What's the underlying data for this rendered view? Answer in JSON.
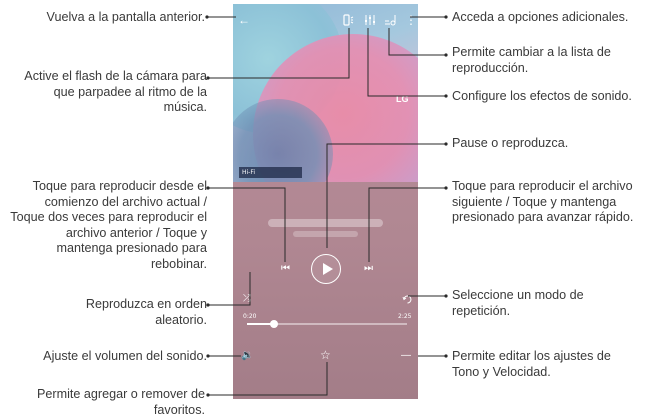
{
  "annotations": {
    "back": "Vuelva a la pantalla anterior.",
    "flash": "Active el flash de la cámara para que parpadee al ritmo de la música.",
    "restart": "Toque para reproducir desde el comienzo del archivo actual / Toque dos veces para reproducir el archivo anterior / Toque y mantenga presionado para rebobinar.",
    "shuffle": "Reproduzca en orden aleatorio.",
    "volume": "Ajuste el volumen del sonido.",
    "favorite": "Permite agregar o remover de favoritos.",
    "more": "Acceda a opciones adicionales.",
    "playlist": "Permite cambiar a la lista de reproducción.",
    "effects": "Configure los efectos de sonido.",
    "play": "Pause o reproduzca.",
    "next": "Toque para reproducir el archivo siguiente / Toque y mantenga presionado para avanzar rápido.",
    "repeat": "Seleccione un modo de repetición.",
    "pitch": "Permite editar los ajustes de Tono y Velocidad."
  },
  "player": {
    "hifi_badge": "Hi-Fi",
    "brand": "LG",
    "elapsed": "0:20",
    "total": "2:25",
    "progress": 0.17,
    "icons": {
      "back": "back-arrow-icon",
      "flash": "flash-icon",
      "effects": "equalizer-icon",
      "playlist": "playlist-icon",
      "more": "more-vertical-icon",
      "prev": "previous-icon",
      "play": "play-icon",
      "next": "next-icon",
      "shuffle": "shuffle-icon",
      "repeat": "repeat-icon",
      "volume": "volume-icon",
      "favorite": "star-icon",
      "pitch": "pitch-speed-icon"
    }
  }
}
